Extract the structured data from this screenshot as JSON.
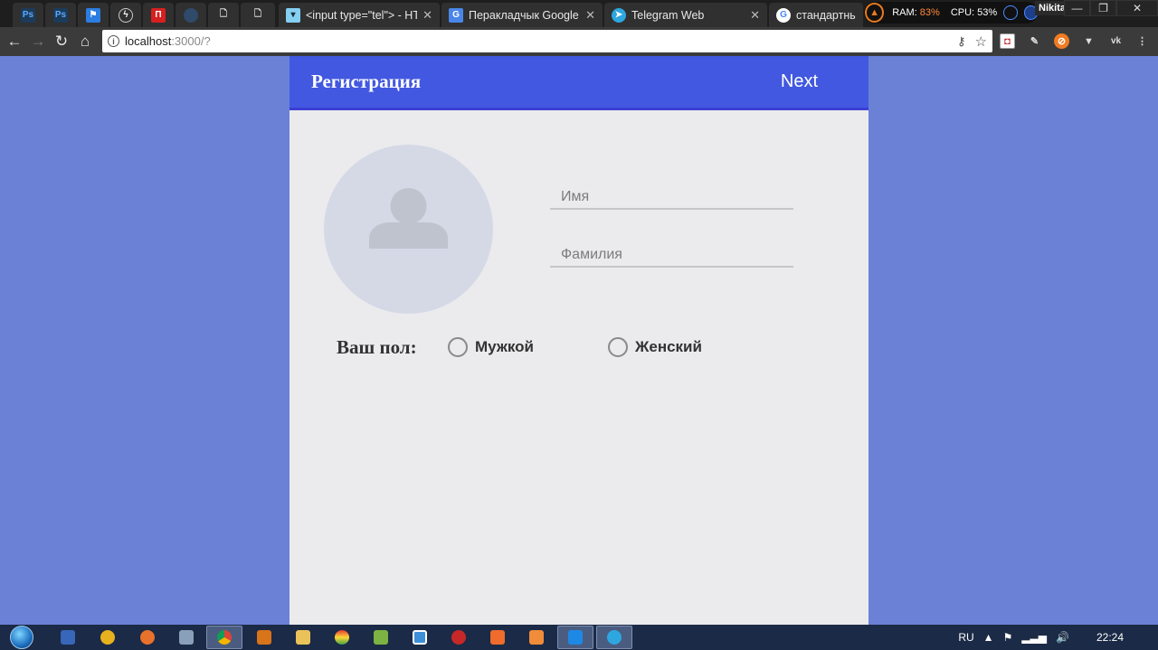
{
  "browser": {
    "tabs": [
      {
        "label": "",
        "icon": "ps-icon",
        "pinned": true
      },
      {
        "label": "",
        "icon": "ps-icon",
        "pinned": true
      },
      {
        "label": "",
        "icon": "flag-icon",
        "pinned": true
      },
      {
        "label": "",
        "icon": "bolt-icon",
        "pinned": true
      },
      {
        "label": "",
        "icon": "red-square-icon",
        "pinned": true
      },
      {
        "label": "",
        "icon": "blank-icon",
        "pinned": true
      },
      {
        "label": "",
        "icon": "page-icon",
        "pinned": true
      },
      {
        "label": "",
        "icon": "page-icon",
        "pinned": true
      },
      {
        "label": "<input type=\"tel\"> - HTM",
        "icon": "mdn-icon",
        "pinned": false
      },
      {
        "label": "Перакладчык Google",
        "icon": "google-translate-icon",
        "pinned": false
      },
      {
        "label": "Telegram Web",
        "icon": "telegram-icon",
        "pinned": false
      },
      {
        "label": "стандартные ц",
        "icon": "google-icon",
        "pinned": false
      }
    ],
    "system_monitor": {
      "ram_label": "RAM:",
      "ram_value": "83%",
      "cpu_label": "CPU:",
      "cpu_value": "53%"
    },
    "profile_name": "Nikita",
    "address": {
      "host": "localhost",
      "path": ":3000/?"
    }
  },
  "app": {
    "title": "Регистрация",
    "next_label": "Next",
    "first_name_placeholder": "Имя",
    "last_name_placeholder": "Фамилия",
    "gender_label": "Ваш пол:",
    "gender_options": [
      "Мужкой",
      "Женский"
    ]
  },
  "taskbar": {
    "language": "RU",
    "time": "22:24"
  },
  "colors": {
    "page_background": "#6a81d6",
    "appbar": "#4258e0",
    "form_background": "#ebeaed",
    "avatar_background": "#d5d9e6"
  }
}
